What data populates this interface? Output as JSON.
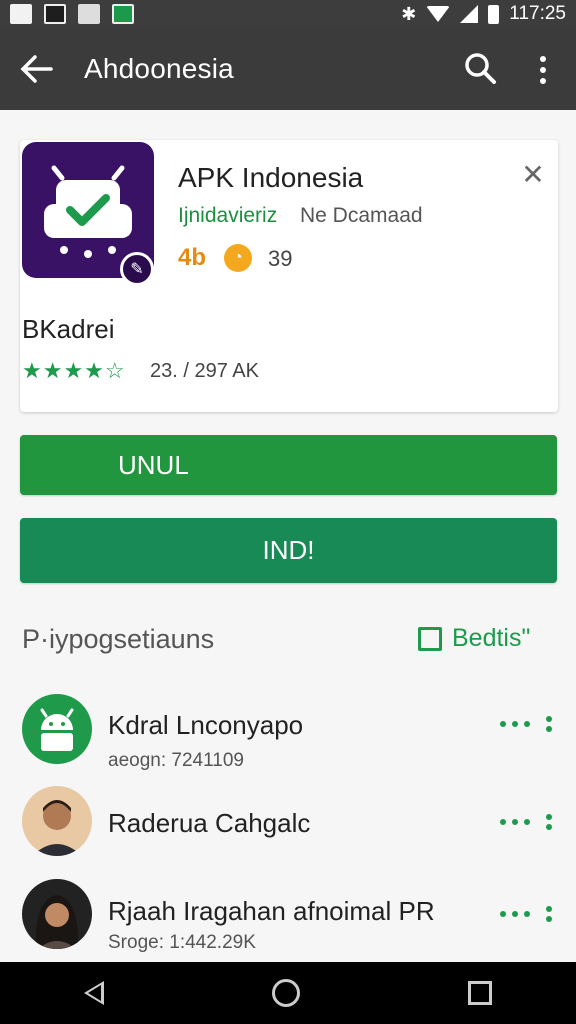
{
  "status_bar": {
    "time": "117:25",
    "icons": [
      "image-icon",
      "gallery-icon",
      "cloud-icon",
      "app-icon",
      "bluetooth-icon",
      "wifi-icon",
      "signal-icon",
      "battery-icon"
    ]
  },
  "app_bar": {
    "title": "Ahdoonesia",
    "back_icon": "arrow-left-icon",
    "search_icon": "search-icon",
    "more_icon": "more-vert-icon"
  },
  "app_card": {
    "name": "APK Indonesia",
    "developer": "Ijnidavieriz",
    "developer_note": "Ne Dcamaad",
    "rating_badge": "4b",
    "coin_count": "39",
    "category": "BKadrei",
    "stars": "★★★★☆",
    "review_count": "23. / 297 AK",
    "close_icon": "close-icon"
  },
  "buttons": {
    "primary_label": "UNUL",
    "secondary_label": "IND!"
  },
  "section": {
    "title": "P·iypogsetiauns",
    "action_label": "Bedtis\"",
    "action_icon": "external-link-icon"
  },
  "list": [
    {
      "name": "Kdral Lnconyapo",
      "sub": "aeogn: 7241109",
      "avatar": "android-avatar"
    },
    {
      "name": "Raderua Cahgalc",
      "sub": "",
      "avatar": "person-avatar"
    },
    {
      "name": "Rjaah Iragahan afnoimal PR",
      "sub": "Sroge: 1:442.29K",
      "avatar": "person-avatar"
    }
  ],
  "colors": {
    "app_bar": "#3b3b3b",
    "accent_green": "#1e9a4d",
    "button_primary": "#22963e",
    "button_secondary": "#178a56",
    "icon_purple": "#3a1265"
  },
  "nav_bar": {
    "icons": [
      "nav-back-icon",
      "nav-home-icon",
      "nav-recent-icon"
    ]
  }
}
